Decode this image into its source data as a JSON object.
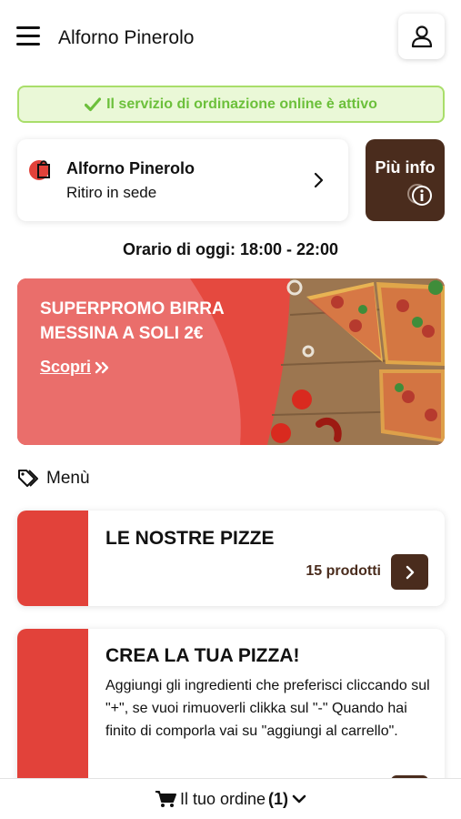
{
  "header": {
    "title": "Alforno Pinerolo",
    "menu_icon": "hamburger-icon",
    "user_icon": "user-icon"
  },
  "status": {
    "text": "Il servizio di ordinazione online è attivo",
    "color": "#6cc03b"
  },
  "store": {
    "name": "Alforno Pinerolo",
    "mode": "Ritiro in sede"
  },
  "info_button": {
    "label": "Più info"
  },
  "hours": {
    "text": "Orario di oggi: 18:00 - 22:00"
  },
  "promo": {
    "title": "SUPERPROMO BIRRA MESSINA A SOLI 2€",
    "link": "Scopri"
  },
  "menu": {
    "heading": "Menù"
  },
  "categories": [
    {
      "title": "LE NOSTRE PIZZE",
      "count": "15 prodotti"
    },
    {
      "title": "CREA LA TUA PIZZA!",
      "description": "Aggiungi gli ingredienti che preferisci cliccando sul \"+\", se vuoi rimuoverli clikka sul \"-\" Quando hai finito di comporla vai su \"aggiungi al carrello\"."
    }
  ],
  "footer": {
    "label": "Il tuo ordine",
    "count": "(1)"
  },
  "colors": {
    "accent_red": "#e2423a",
    "brand_brown": "#4a2c1d",
    "success_green": "#6cc03b"
  }
}
